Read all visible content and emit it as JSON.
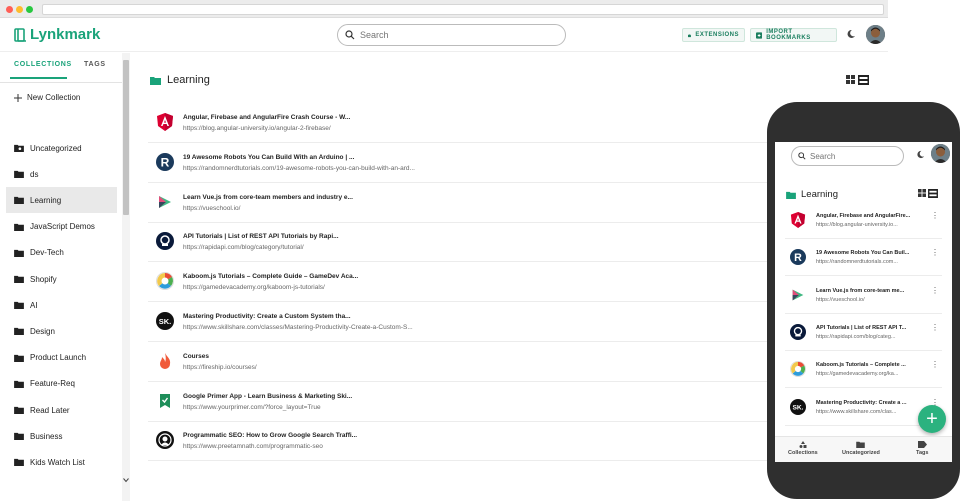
{
  "app": {
    "name": "Lynkmark"
  },
  "header": {
    "search_placeholder": "Search",
    "extensions_label": "EXTENSIONS",
    "import_label": "IMPORT BOOKMARKS"
  },
  "sidebar": {
    "tabs": [
      {
        "label": "COLLECTIONS"
      },
      {
        "label": "TAGS"
      }
    ],
    "new_collection": "New Collection",
    "items": [
      {
        "label": "Uncategorized",
        "icon": "folder-special-icon"
      },
      {
        "label": "ds",
        "icon": "folder-icon"
      },
      {
        "label": "Learning",
        "icon": "folder-icon",
        "active": true
      },
      {
        "label": "JavaScript Demos",
        "icon": "folder-icon"
      },
      {
        "label": "Dev-Tech",
        "icon": "folder-icon"
      },
      {
        "label": "Shopify",
        "icon": "folder-icon"
      },
      {
        "label": "AI",
        "icon": "folder-icon"
      },
      {
        "label": "Design",
        "icon": "folder-icon"
      },
      {
        "label": "Product Launch",
        "icon": "folder-icon"
      },
      {
        "label": "Feature-Req",
        "icon": "folder-icon"
      },
      {
        "label": "Read Later",
        "icon": "folder-icon"
      },
      {
        "label": "Business",
        "icon": "folder-icon"
      },
      {
        "label": "Kids Watch List",
        "icon": "folder-icon"
      }
    ]
  },
  "main": {
    "title": "Learning",
    "bookmarks": [
      {
        "title": "Angular, Firebase and AngularFire Crash Course - W...",
        "url": "https://blog.angular-university.io/angular-2-firebase/",
        "icon": "angular-icon"
      },
      {
        "title": "19 Awesome Robots You Can Build With an Arduino | ...",
        "url": "https://randomnerdtutorials.com/19-awesome-robots-you-can-build-with-an-ard...",
        "icon": "rnt-icon"
      },
      {
        "title": "Learn Vue.js from core-team members and industry e...",
        "url": "https://vueschool.io/",
        "icon": "vueschool-icon"
      },
      {
        "title": "API Tutorials | List of REST API Tutorials by Rapi...",
        "url": "https://rapidapi.com/blog/category/tutorial/",
        "icon": "rapidapi-icon"
      },
      {
        "title": "Kaboom.js Tutorials – Complete Guide – GameDev Aca...",
        "url": "https://gamedevacademy.org/kaboom-js-tutorials/",
        "icon": "gamedev-icon"
      },
      {
        "title": "Mastering Productivity: Create a Custom System tha...",
        "url": "https://www.skillshare.com/classes/Mastering-Productivity-Create-a-Custom-S...",
        "icon": "skillshare-icon"
      },
      {
        "title": "Courses",
        "url": "https://fireship.io/courses/",
        "icon": "fireship-icon"
      },
      {
        "title": "Google Primer App - Learn Business & Marketing Ski...",
        "url": "https://www.yourprimer.com/?force_layout=True",
        "icon": "primer-icon"
      },
      {
        "title": "Programmatic SEO: How to Grow Google Search Traffi...",
        "url": "https://www.preetamnath.com/programmatic-seo",
        "icon": "preetam-icon"
      }
    ]
  },
  "mobile": {
    "search_placeholder": "Search",
    "title": "Learning",
    "bookmarks": [
      {
        "title": "Angular, Firebase and AngularFire...",
        "url": "https://blog.angular-university.io...",
        "icon": "angular-icon"
      },
      {
        "title": "19 Awesome Robots You Can Buil...",
        "url": "https://randomnerdtutorials.com...",
        "icon": "rnt-icon"
      },
      {
        "title": "Learn Vue.js from core-team me...",
        "url": "https://vueschool.io/",
        "icon": "vueschool-icon"
      },
      {
        "title": "API Tutorials | List of REST API T...",
        "url": "https://rapidapi.com/blog/categ...",
        "icon": "rapidapi-icon"
      },
      {
        "title": "Kaboom.js Tutorials – Complete ...",
        "url": "https://gamedevacademy.org/ka...",
        "icon": "gamedev-icon"
      },
      {
        "title": "Mastering Productivity: Create a ...",
        "url": "https://www.skillshare.com/clas...",
        "icon": "skillshare-icon"
      }
    ],
    "nav": [
      {
        "label": "Collections",
        "icon": "collections-icon"
      },
      {
        "label": "Uncategorized",
        "icon": "folder-special-icon"
      },
      {
        "label": "Tags",
        "icon": "tag-icon"
      }
    ]
  },
  "colors": {
    "accent": "#1aa37a",
    "fab": "#2bb27f",
    "angular": "#dd0031",
    "phone_body": "#2f2f2f"
  }
}
